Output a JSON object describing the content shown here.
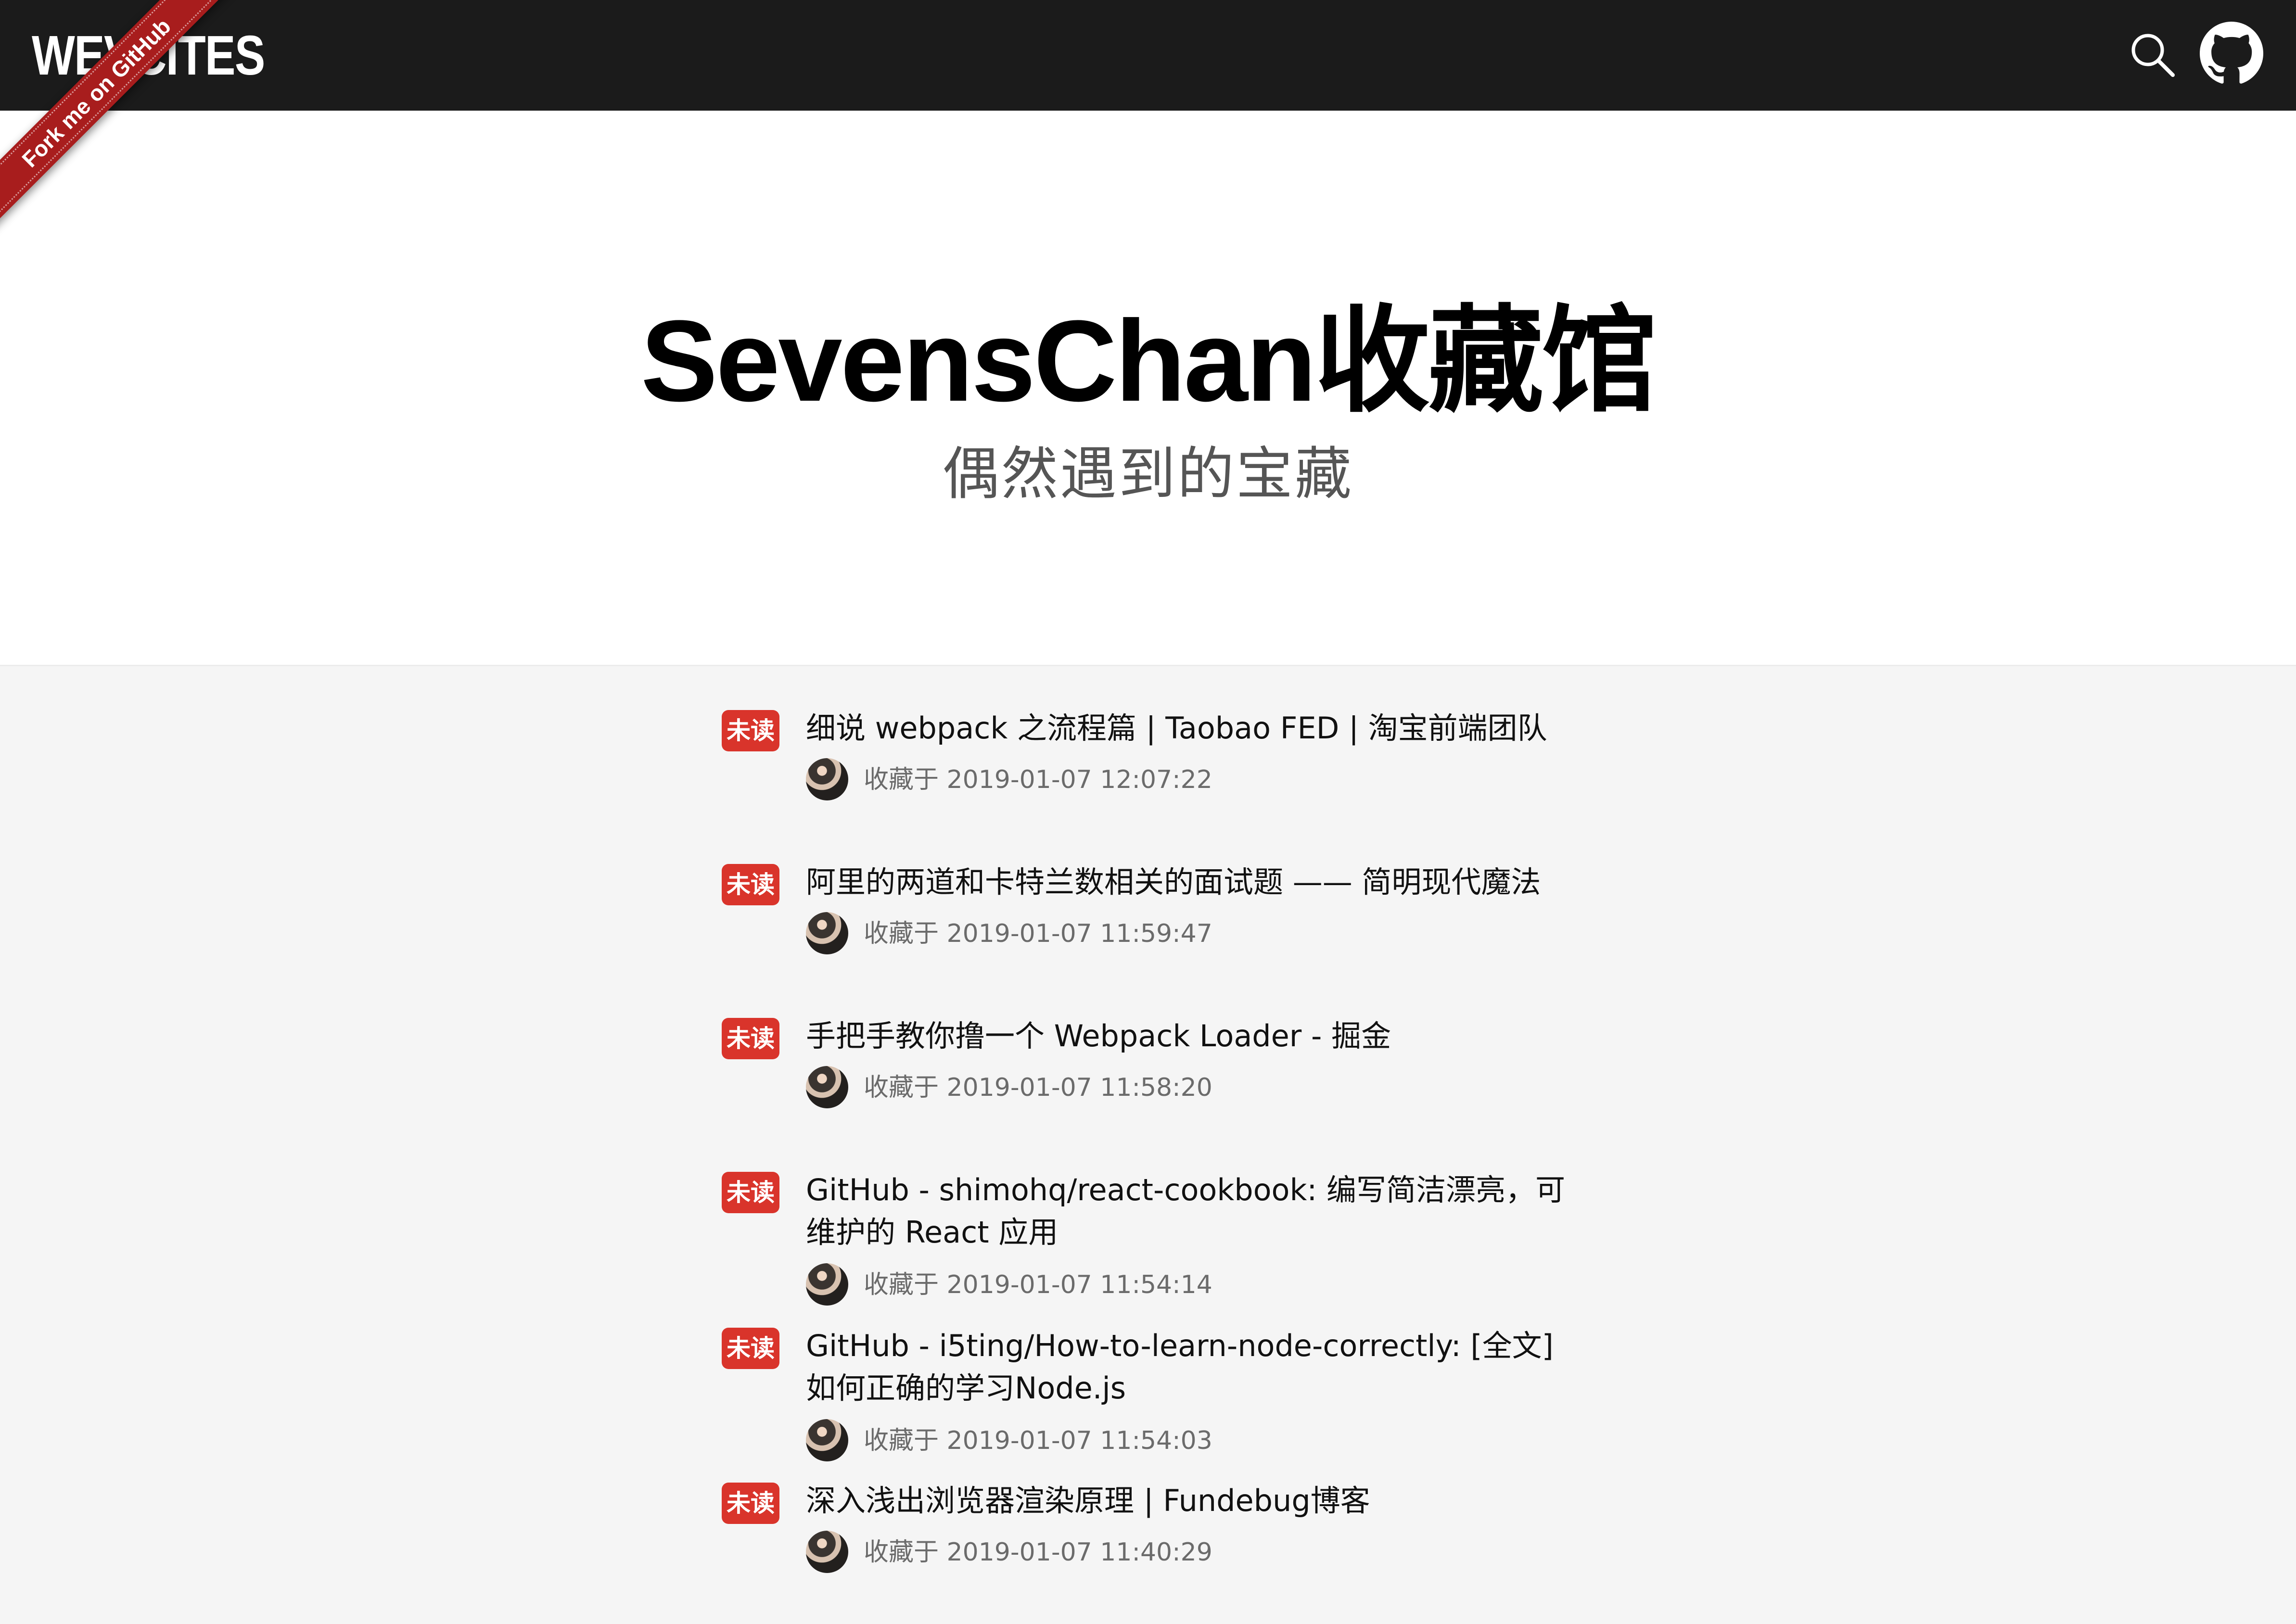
{
  "header": {
    "logo": "WEVCITES",
    "search_icon": "search-icon",
    "github_icon": "github-icon"
  },
  "ribbon": {
    "text": "Fork me on GitHub",
    "color": "#a81d1d"
  },
  "hero": {
    "title": "SevensChan收藏馆",
    "subtitle": "偶然遇到的宝藏"
  },
  "articles": [
    {
      "badge": "未读",
      "title": "细说 webpack 之流程篇 | Taobao FED | 淘宝前端团队",
      "saved_prefix": "收藏于",
      "saved_at": "2019-01-07 12:07:22"
    },
    {
      "badge": "未读",
      "title": "阿里的两道和卡特兰数相关的面试题 —— 简明现代魔法",
      "saved_prefix": "收藏于",
      "saved_at": "2019-01-07 11:59:47"
    },
    {
      "badge": "未读",
      "title": "手把手教你撸一个 Webpack Loader - 掘金",
      "saved_prefix": "收藏于",
      "saved_at": "2019-01-07 11:58:20"
    },
    {
      "badge": "未读",
      "title": "GitHub - shimohq/react-cookbook: 编写简洁漂亮，可维护的 React 应用",
      "saved_prefix": "收藏于",
      "saved_at": "2019-01-07 11:54:14"
    },
    {
      "badge": "未读",
      "title": "GitHub - i5ting/How-to-learn-node-correctly: [全文]如何正确的学习Node.js",
      "saved_prefix": "收藏于",
      "saved_at": "2019-01-07 11:54:03"
    },
    {
      "badge": "未读",
      "title": "深入浅出浏览器渲染原理 | Fundebug博客",
      "saved_prefix": "收藏于",
      "saved_at": "2019-01-07 11:40:29"
    }
  ],
  "colors": {
    "header_bg": "#1b1b1b",
    "badge_bg": "#d9342b",
    "page_bg": "#f5f5f5"
  }
}
